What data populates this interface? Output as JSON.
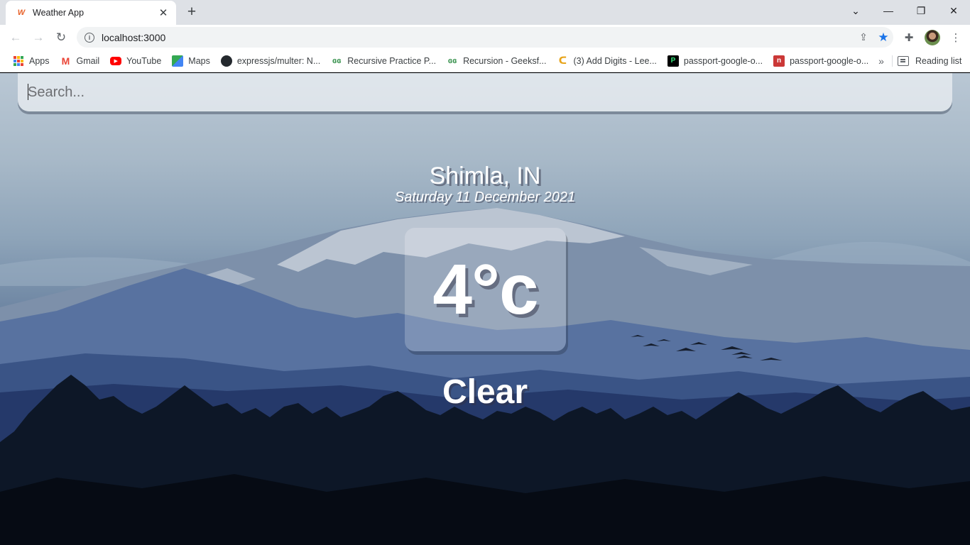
{
  "browser": {
    "tab_title": "Weather App",
    "tab_favicon": "W",
    "url": "localhost:3000",
    "bookmarks": [
      {
        "label": "Apps",
        "icon": "apps-grid-icon"
      },
      {
        "label": "Gmail",
        "icon": "gmail-icon"
      },
      {
        "label": "YouTube",
        "icon": "youtube-icon"
      },
      {
        "label": "Maps",
        "icon": "maps-icon"
      },
      {
        "label": "expressjs/multer: N...",
        "icon": "github-icon"
      },
      {
        "label": "Recursive Practice P...",
        "icon": "geeksforgeeks-icon"
      },
      {
        "label": "Recursion - Geeksf...",
        "icon": "geeksforgeeks-icon"
      },
      {
        "label": "(3) Add Digits - Lee...",
        "icon": "leetcode-icon"
      },
      {
        "label": "passport-google-o...",
        "icon": "passport-icon"
      },
      {
        "label": "passport-google-o...",
        "icon": "npm-icon"
      }
    ],
    "overflow": "»",
    "reading_list": "Reading list"
  },
  "search": {
    "placeholder": "Search...",
    "value": ""
  },
  "weather": {
    "location": "Shimla, IN",
    "date": "Saturday 11 December 2021",
    "temperature": "4°c",
    "condition": "Clear"
  },
  "colors": {
    "sky_top": "#b9c7d4",
    "mountain_mid": "#4d6a92",
    "forest": "#0b1424",
    "star_accent": "#1a73e8"
  }
}
